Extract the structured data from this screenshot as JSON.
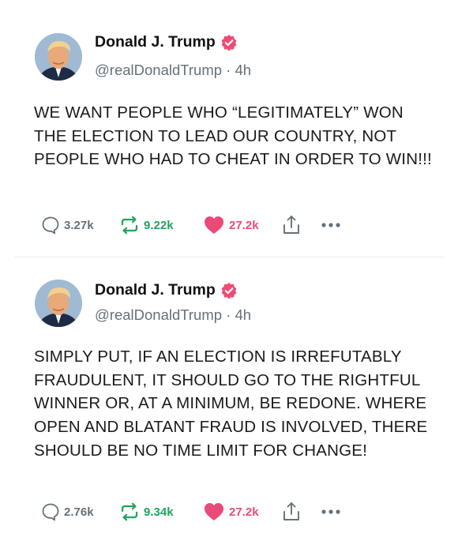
{
  "posts": [
    {
      "author": "Donald J. Trump",
      "handle": "@realDonaldTrump",
      "separator": "·",
      "time": "4h",
      "text": "WE WANT PEOPLE WHO “LEGITIMATELY” WON THE ELECTION TO LEAD OUR COUNTRY, NOT PEOPLE WHO HAD TO CHEAT IN ORDER TO WIN!!!",
      "replies": "3.27k",
      "reposts": "9.22k",
      "likes": "27.2k"
    },
    {
      "author": "Donald J. Trump",
      "handle": "@realDonaldTrump",
      "separator": "·",
      "time": "4h",
      "text": "SIMPLY PUT, IF AN ELECTION IS IRREFUTABLY FRAUDULENT, IT SHOULD GO TO THE RIGHTFUL WINNER OR, AT A MINIMUM, BE REDONE. WHERE OPEN AND BLATANT FRAUD IS INVOLVED, THERE SHOULD BE NO TIME LIMIT FOR CHANGE!",
      "replies": "2.76k",
      "reposts": "9.34k",
      "likes": "27.2k"
    }
  ],
  "icons": {
    "verified": "verified-badge-icon",
    "reply": "reply-bubble-icon",
    "repost": "repost-arrows-icon",
    "like": "heart-icon",
    "share": "share-upload-icon",
    "more": "more-dots-icon"
  },
  "colors": {
    "verified_badge": "#ee4b73",
    "repost": "#1fa35c",
    "like": "#ea4a78",
    "muted": "#66707a"
  }
}
